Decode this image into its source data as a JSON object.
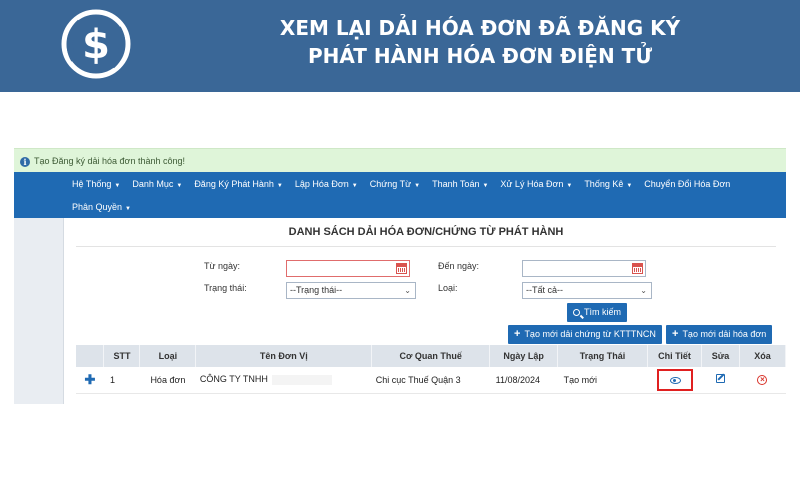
{
  "banner": {
    "title_line1": "XEM LẠI DẢI HÓA ĐƠN ĐÃ ĐĂNG KÝ",
    "title_line2": "PHÁT HÀNH HÓA ĐƠN ĐIỆN TỬ",
    "colors": {
      "background": "#3a6797",
      "text": "#ffffff"
    },
    "logo_icon": "dollar-coin-icon"
  },
  "alert": {
    "icon": "info-icon",
    "message": "Tạo Đăng ký dải hóa đơn thành công!"
  },
  "nav": {
    "row1": [
      "Hệ Thống",
      "Danh Mục",
      "Đăng Ký Phát Hành",
      "Lập Hóa Đơn",
      "Chứng Từ",
      "Thanh Toán",
      "Xử Lý Hóa Đơn",
      "Thống Kê"
    ],
    "last_item": "Chuyển Đổi Hóa Đơn",
    "row2": [
      "Phân Quyền"
    ]
  },
  "page": {
    "title": "DANH SÁCH DẢI HÓA ĐƠN/CHỨNG TỪ PHÁT HÀNH"
  },
  "filters": {
    "from_label": "Từ ngày:",
    "to_label": "Đến ngày:",
    "status_label": "Trạng thái:",
    "status_value": "--Trạng thái--",
    "type_label": "Loại:",
    "type_value": "--Tất cả--",
    "search_button": "Tìm kiếm"
  },
  "actions": {
    "create_certificate_range": "Tạo mới dải chứng từ KTTTNCN",
    "create_invoice_range": "Tạo mới dải hóa đơn"
  },
  "table": {
    "headers": [
      "",
      "STT",
      "Loại",
      "Tên Đơn Vị",
      "Cơ Quan Thuế",
      "Ngày Lập",
      "Trạng Thái",
      "Chi Tiết",
      "Sửa",
      "Xóa"
    ],
    "rows": [
      {
        "stt": "1",
        "type": "Hóa đơn",
        "unit": "CÔNG TY TNHH",
        "tax_office": "Chi cục Thuế Quận 3",
        "date": "11/08/2024",
        "status": "Tạo mới"
      }
    ]
  },
  "colors": {
    "navbar": "#1f6ab3",
    "alert_bg": "#dff5d9",
    "highlight": "#e02020"
  }
}
